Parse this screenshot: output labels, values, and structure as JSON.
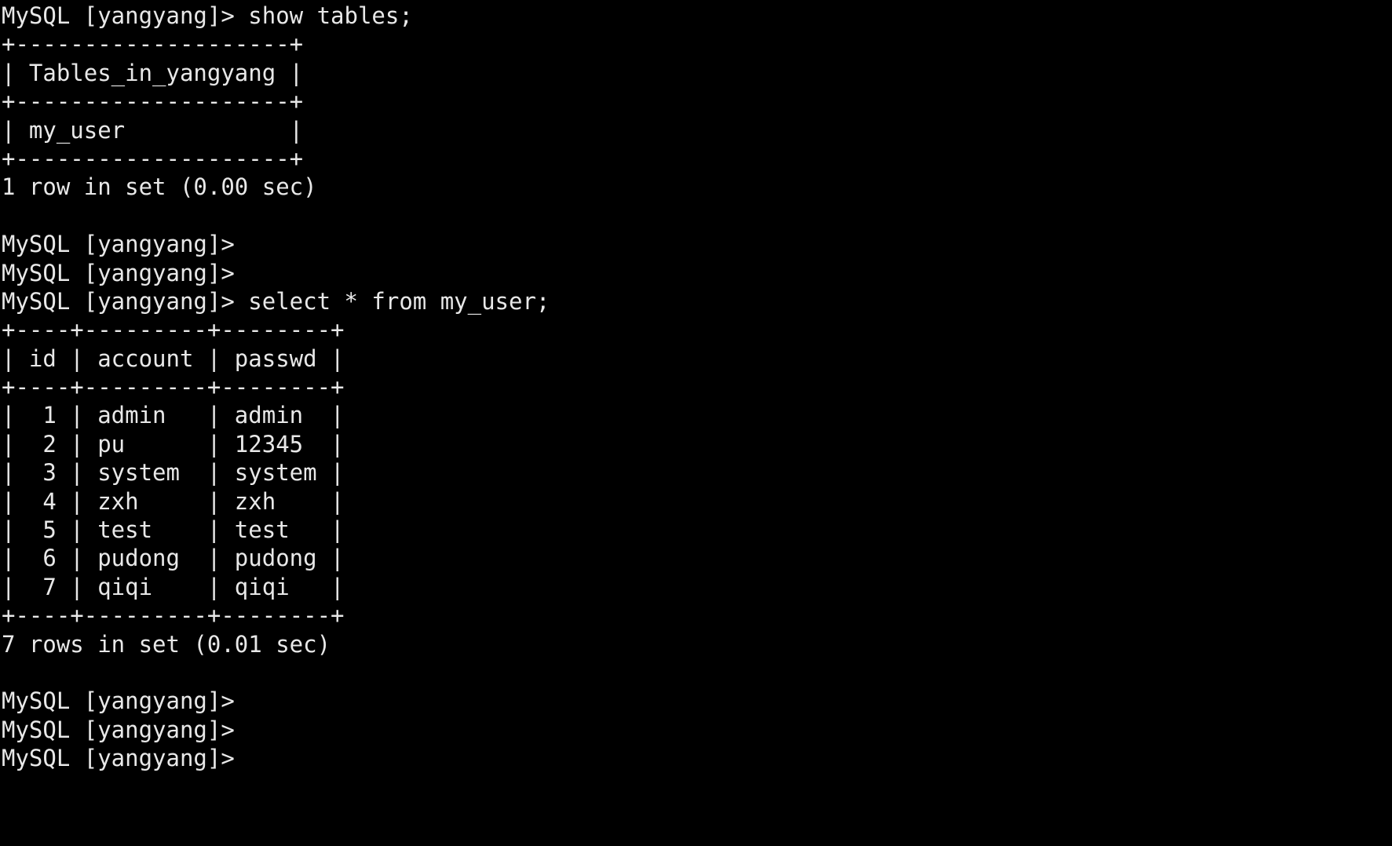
{
  "terminal": {
    "app": "mysql-client",
    "colors": {
      "background": "#000000",
      "foreground": "#e8e8e8"
    },
    "prompt": "MySQL [yangyang]>",
    "database": "yangyang",
    "lines": [
      "MySQL [yangyang]> show tables;",
      "+--------------------+",
      "| Tables_in_yangyang |",
      "+--------------------+",
      "| my_user            |",
      "+--------------------+",
      "1 row in set (0.00 sec)",
      "",
      "MySQL [yangyang]>",
      "MySQL [yangyang]>",
      "MySQL [yangyang]> select * from my_user;",
      "+----+---------+--------+",
      "| id | account | passwd |",
      "+----+---------+--------+",
      "|  1 | admin   | admin  |",
      "|  2 | pu      | 12345  |",
      "|  3 | system  | system |",
      "|  4 | zxh     | zxh    |",
      "|  5 | test    | test   |",
      "|  6 | pudong  | pudong |",
      "|  7 | qiqi    | qiqi   |",
      "+----+---------+--------+",
      "7 rows in set (0.01 sec)",
      "",
      "MySQL [yangyang]>",
      "MySQL [yangyang]>",
      "MySQL [yangyang]>"
    ],
    "commands": [
      "show tables;",
      "select * from my_user;"
    ],
    "results": {
      "show_tables": {
        "header": "Tables_in_yangyang",
        "rows": [
          "my_user"
        ],
        "status": "1 row in set (0.00 sec)"
      },
      "select_my_user": {
        "headers": [
          "id",
          "account",
          "passwd"
        ],
        "rows": [
          [
            "1",
            "admin",
            "admin"
          ],
          [
            "2",
            "pu",
            "12345"
          ],
          [
            "3",
            "system",
            "system"
          ],
          [
            "4",
            "zxh",
            "zxh"
          ],
          [
            "5",
            "test",
            "test"
          ],
          [
            "6",
            "pudong",
            "pudong"
          ],
          [
            "7",
            "qiqi",
            "qiqi"
          ]
        ],
        "status": "7 rows in set (0.01 sec)"
      }
    }
  }
}
